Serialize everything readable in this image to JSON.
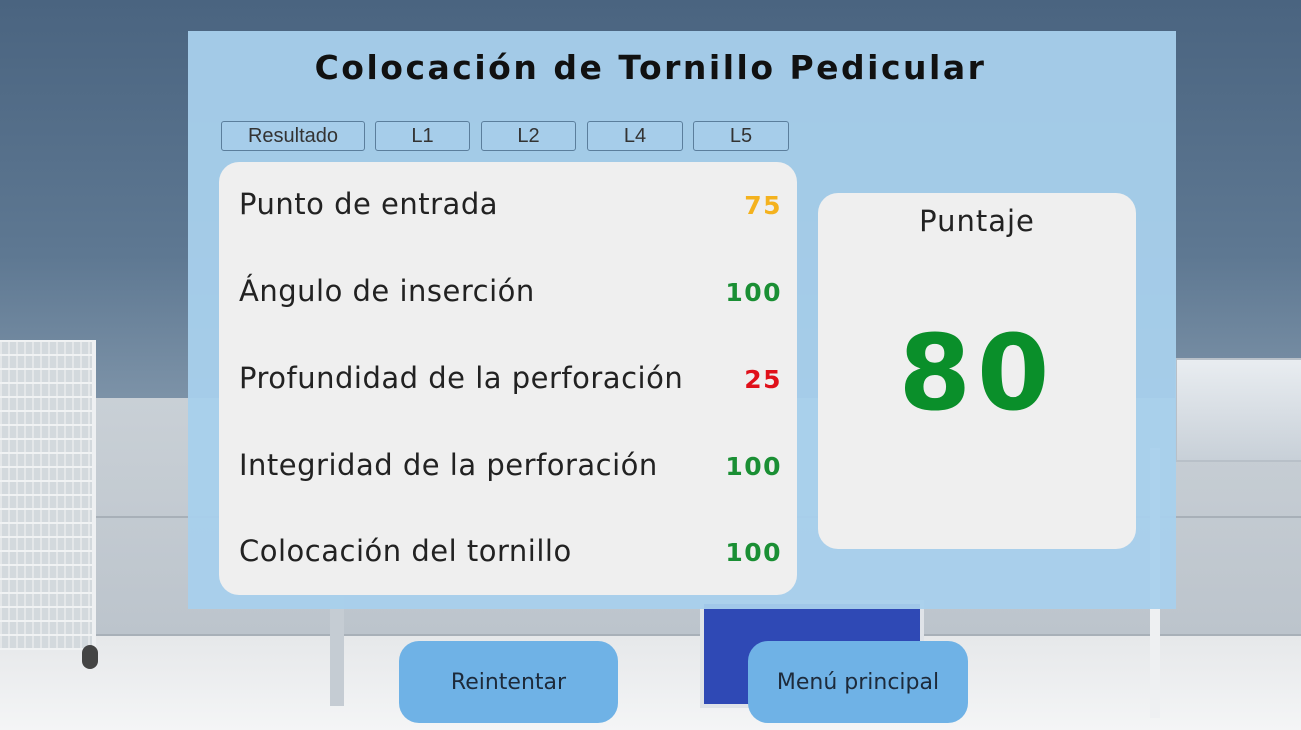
{
  "title": "Colocación de Tornillo Pedicular",
  "tabs": [
    {
      "label": "Resultado"
    },
    {
      "label": "L1"
    },
    {
      "label": "L2"
    },
    {
      "label": "L4"
    },
    {
      "label": "L5"
    }
  ],
  "results": [
    {
      "label": "Punto de entrada",
      "value": "75",
      "color": "#f4b21e"
    },
    {
      "label": "Ángulo de inserción",
      "value": "100",
      "color": "#1a8f34"
    },
    {
      "label": "Profundidad de la perforación",
      "value": "25",
      "color": "#e0101a"
    },
    {
      "label": "Integridad de la perforación",
      "value": "100",
      "color": "#1a8f34"
    },
    {
      "label": "Colocación del tornillo",
      "value": "100",
      "color": "#1a8f34"
    }
  ],
  "score": {
    "label": "Puntaje",
    "value": "80",
    "color": "#0a8f2a"
  },
  "buttons": {
    "retry_label": "Reintentar",
    "menu_label": "Menú principal"
  }
}
